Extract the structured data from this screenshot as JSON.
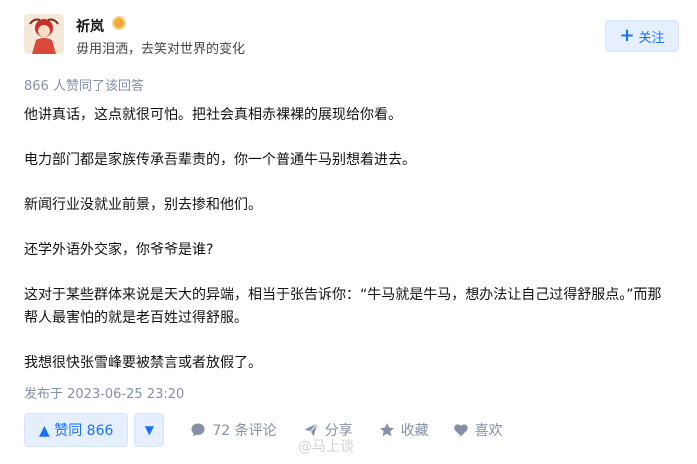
{
  "author": {
    "name": "祈岚",
    "bio": "毋用泪洒，去笑对世界的变化",
    "badge_icon": "gold-medal-icon"
  },
  "follow_button": {
    "label": "关注",
    "icon": "plus-icon"
  },
  "votes_summary": "866 人赞同了该回答",
  "paragraphs": [
    "他讲真话，这点就很可怕。把社会真相赤裸裸的展现给你看。",
    "电力部门都是家族传承吾辈责的，你一个普通牛马别想着进去。",
    "新闻行业没就业前景，别去掺和他们。",
    "还学外语外交家，你爷爷是谁?",
    "这对于某些群体来说是天大的异端，相当于张告诉你：“牛马就是牛马，想办法让自己过得舒服点。”而那帮人最害怕的就是老百姓过得舒服。",
    "我想很快张雪峰要被禁言或者放假了。"
  ],
  "publish_time": "发布于 2023-06-25 23:20",
  "actions": {
    "vote_up_label": "▲ 赞同 866",
    "vote_down_label": "▼",
    "comment_label": "72 条评论",
    "share_label": "分享",
    "favorite_label": "收藏",
    "like_label": "喜欢"
  },
  "watermark": "@马上谈",
  "colors": {
    "accent": "#1772f6",
    "accent_bg": "#e6efff",
    "muted": "#8590a6"
  }
}
